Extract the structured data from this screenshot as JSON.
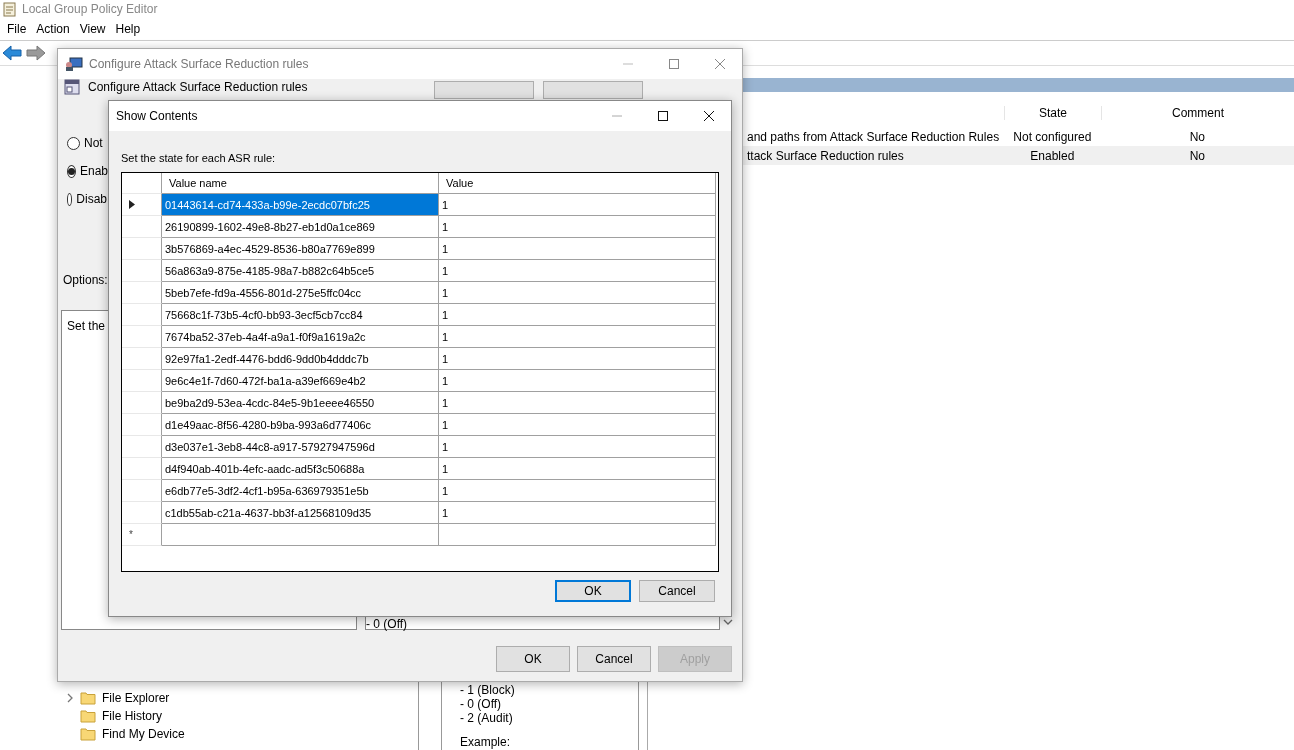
{
  "main_window": {
    "title": "Local Group Policy Editor",
    "menu": [
      "File",
      "Action",
      "View",
      "Help"
    ],
    "tree_items": [
      {
        "label": "File Explorer",
        "expandable": true
      },
      {
        "label": "File History",
        "expandable": false
      },
      {
        "label": "Find My Device",
        "expandable": false
      }
    ],
    "setting_list": {
      "columns": [
        "State",
        "Comment"
      ],
      "rows": [
        {
          "setting": "and paths from Attack Surface Reduction Rules",
          "state": "Not configured",
          "comment": "No",
          "selected": false
        },
        {
          "setting": "ttack Surface Reduction rules",
          "state": "Enabled",
          "comment": "No",
          "selected": true
        }
      ]
    },
    "description_lines": [
      "- 1 (Block)",
      "- 0 (Off)",
      "- 2 (Audit)",
      "Example:"
    ]
  },
  "policy_dialog": {
    "title": "Configure Attack Surface Reduction rules",
    "heading": "Configure Attack Surface Reduction rules",
    "state_options": [
      {
        "label": "Not",
        "selected": false
      },
      {
        "label": "Enab",
        "selected": true
      },
      {
        "label": "Disab",
        "selected": false
      }
    ],
    "options_label": "Options:",
    "options_text": "Set the",
    "help_text": "- 0 (Off)",
    "buttons": [
      {
        "label": "OK",
        "disabled": false
      },
      {
        "label": "Cancel",
        "disabled": false
      },
      {
        "label": "Apply",
        "disabled": true
      }
    ]
  },
  "show_contents": {
    "title": "Show Contents",
    "prompt": "Set the state for each ASR rule:",
    "columns": [
      "Value name",
      "Value"
    ],
    "rows": [
      {
        "name": "01443614-cd74-433a-b99e-2ecdc07bfc25",
        "value": "1",
        "selected": true
      },
      {
        "name": "26190899-1602-49e8-8b27-eb1d0a1ce869",
        "value": "1",
        "selected": false
      },
      {
        "name": "3b576869-a4ec-4529-8536-b80a7769e899",
        "value": "1",
        "selected": false
      },
      {
        "name": "56a863a9-875e-4185-98a7-b882c64b5ce5",
        "value": "1",
        "selected": false
      },
      {
        "name": "5beb7efe-fd9a-4556-801d-275e5ffc04cc",
        "value": "1",
        "selected": false
      },
      {
        "name": "75668c1f-73b5-4cf0-bb93-3ecf5cb7cc84",
        "value": "1",
        "selected": false
      },
      {
        "name": "7674ba52-37eb-4a4f-a9a1-f0f9a1619a2c",
        "value": "1",
        "selected": false
      },
      {
        "name": "92e97fa1-2edf-4476-bdd6-9dd0b4dddc7b",
        "value": "1",
        "selected": false
      },
      {
        "name": "9e6c4e1f-7d60-472f-ba1a-a39ef669e4b2",
        "value": "1",
        "selected": false
      },
      {
        "name": "be9ba2d9-53ea-4cdc-84e5-9b1eeee46550",
        "value": "1",
        "selected": false
      },
      {
        "name": "d1e49aac-8f56-4280-b9ba-993a6d77406c",
        "value": "1",
        "selected": false
      },
      {
        "name": "d3e037e1-3eb8-44c8-a917-57927947596d",
        "value": "1",
        "selected": false
      },
      {
        "name": "d4f940ab-401b-4efc-aadc-ad5f3c50688a",
        "value": "1",
        "selected": false
      },
      {
        "name": "e6db77e5-3df2-4cf1-b95a-636979351e5b",
        "value": "1",
        "selected": false
      },
      {
        "name": "c1db55ab-c21a-4637-bb3f-a12568109d35",
        "value": "1",
        "selected": false
      }
    ],
    "new_row_marker": "*",
    "buttons": [
      {
        "label": "OK",
        "default": true
      },
      {
        "label": "Cancel",
        "default": false
      }
    ]
  }
}
